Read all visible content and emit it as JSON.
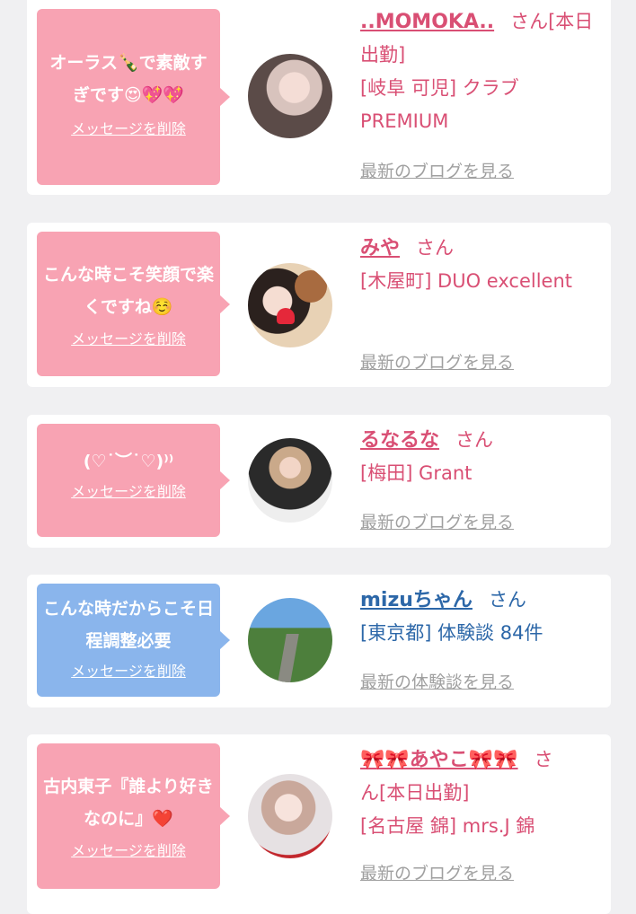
{
  "cards": [
    {
      "message": "オーラス🍾で素敵すぎです😍💖💖",
      "delete_label": "メッセージを削除",
      "name": "..MOMOKA..",
      "san": "さん",
      "status": "[本日出勤]",
      "shop": "[岐阜 可児] クラブPREMIUM",
      "blog_link": "最新のブログを見る",
      "bubble_color": "#f8a3b3"
    },
    {
      "message": "こんな時こそ笑顔で楽くですね☺️",
      "delete_label": "メッセージを削除",
      "name": "みや",
      "san": "さん",
      "shop": "[木屋町] DUO excellent",
      "blog_link": "最新のブログを見る",
      "bubble_color": "#f8a3b3"
    },
    {
      "message": "(♡˙︶˙♡)⁾⁾",
      "delete_label": "メッセージを削除",
      "name": "るなるな",
      "san": "さん",
      "shop": "[梅田] Grant",
      "blog_link": "最新のブログを見る",
      "bubble_color": "#f8a3b3"
    },
    {
      "message": "こんな時だからこそ日程調整必要",
      "delete_label": "メッセージを削除",
      "name": "mizuちゃん",
      "san": "さん",
      "shop": "[東京都] 体験談 84件",
      "blog_link": "最新の体験談を見る",
      "bubble_color": "#8ab5ec"
    },
    {
      "message": "古内東子『誰より好きなのに』❤️",
      "delete_label": "メッセージを削除",
      "name": "🎀🎀あやこ🎀🎀",
      "san": "さ",
      "name_tail": "ん[本日出勤]",
      "shop": "[名古屋 錦] mrs.J 錦",
      "blog_link": "最新のブログを見る",
      "bubble_color": "#f8a3b3"
    }
  ]
}
